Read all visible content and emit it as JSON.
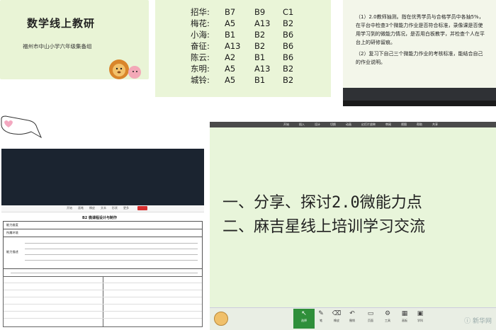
{
  "panel1": {
    "title": "数学线上教研",
    "subtitle": "福州市中山小学六年级集备组"
  },
  "panel2": {
    "rows": [
      {
        "name": "招华:",
        "a": "B7",
        "b": "B9",
        "c": "C1"
      },
      {
        "name": "梅花:",
        "a": "A5",
        "b": "A13",
        "c": "B2"
      },
      {
        "name": "小海:",
        "a": "B1",
        "b": "B2",
        "c": "B6"
      },
      {
        "name": "奋征:",
        "a": "A13",
        "b": "B2",
        "c": "B6"
      },
      {
        "name": "陈云:",
        "a": "A2",
        "b": "B1",
        "c": "B6"
      },
      {
        "name": "东明:",
        "a": "A5",
        "b": "A13",
        "c": "B2"
      },
      {
        "name": "城铃:",
        "a": "A5",
        "b": "B1",
        "c": "B2"
      }
    ]
  },
  "panel3": {
    "para1": "（1）2.0教师抽测。指在优秀学员与合格学员中各抽5%，在平台中检查3个微能力作业是否符合标准，录像课是否使用学习到的微能力情况，是否用白板教学，并检查个人在平台上的研修留痕。",
    "para2": "（2）复习下自己三个微能力作业的考核标准，能结合自己的作业说明。"
  },
  "panel4": {
    "doc_title": "B2 微课程设计与制作",
    "labels": {
      "ability": "能力维度",
      "env": "所属环境",
      "desc": "能力描述"
    },
    "tool_labels": [
      "开始",
      "画笔",
      "橡皮",
      "文本",
      "形状",
      "更多"
    ]
  },
  "panel5": {
    "menu": [
      "开始",
      "插入",
      "设计",
      "切换",
      "动画",
      "幻灯片放映",
      "审阅",
      "视图",
      "帮助",
      "共享"
    ],
    "line1": "一、分享、探讨2.0微能力点",
    "line2": "二、麻吉星线上培训学习交流",
    "bottom_tools": [
      {
        "icon": "↖",
        "label": "选择"
      },
      {
        "icon": "✎",
        "label": "笔"
      },
      {
        "icon": "⌫",
        "label": "橡皮"
      },
      {
        "icon": "↶",
        "label": "撤销"
      },
      {
        "icon": "▭",
        "label": "页面"
      },
      {
        "icon": "⚙",
        "label": "工具"
      },
      {
        "icon": "▦",
        "label": "画板"
      },
      {
        "icon": "▣",
        "label": "学科"
      }
    ],
    "watermark": "ⓘ 新华网"
  }
}
